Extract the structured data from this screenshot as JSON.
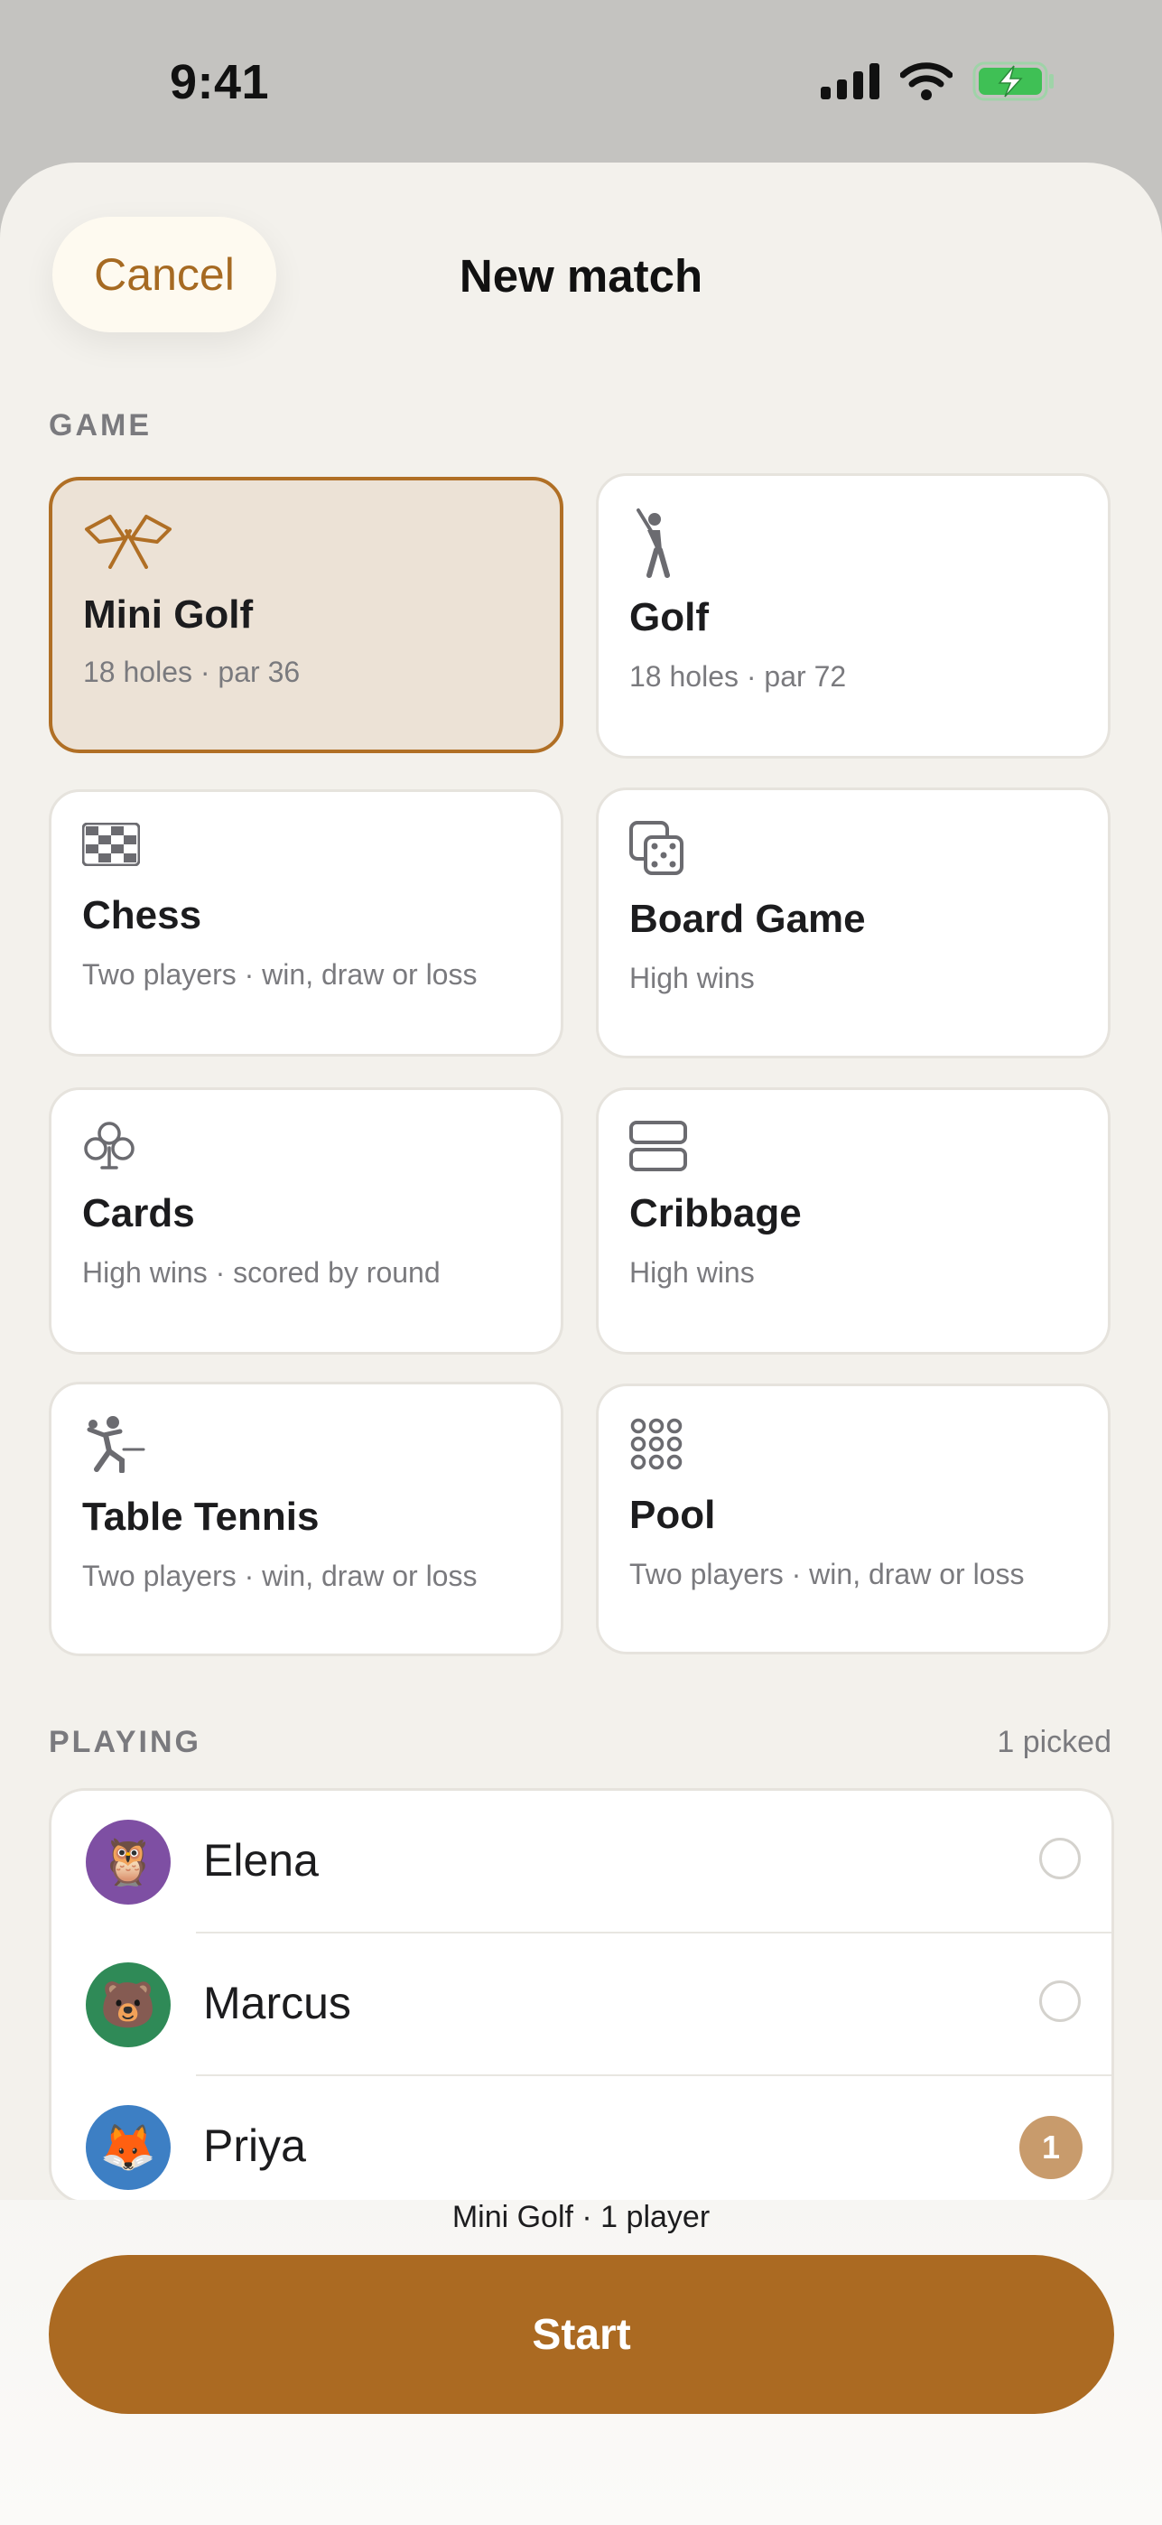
{
  "status_bar": {
    "time": "9:41"
  },
  "nav": {
    "cancel_label": "Cancel",
    "title": "New match"
  },
  "game_section": {
    "label": "GAME",
    "games": [
      {
        "name": "Mini Golf",
        "detail": "18 holes · par 36",
        "icon": "crossed-flags-icon",
        "selected": true
      },
      {
        "name": "Golf",
        "detail": "18 holes · par 72",
        "icon": "golfer-icon",
        "selected": false
      },
      {
        "name": "Chess",
        "detail": "Two players · win, draw or loss",
        "icon": "checkerboard-icon",
        "selected": false
      },
      {
        "name": "Board Game",
        "detail": "High wins",
        "icon": "dice-icon",
        "selected": false
      },
      {
        "name": "Cards",
        "detail": "High wins · scored by round",
        "icon": "club-suit-icon",
        "selected": false
      },
      {
        "name": "Cribbage",
        "detail": "High wins",
        "icon": "cribbage-board-icon",
        "selected": false
      },
      {
        "name": "Table Tennis",
        "detail": "Two players · win, draw or loss",
        "icon": "table-tennis-player-icon",
        "selected": false
      },
      {
        "name": "Pool",
        "detail": "Two players · win, draw or loss",
        "icon": "pool-balls-icon",
        "selected": false
      }
    ]
  },
  "playing_section": {
    "label": "PLAYING",
    "count_text": "1 picked",
    "players": [
      {
        "name": "Elena",
        "avatar": "🦉",
        "avatar_color": "#7e4fa3",
        "picked": false
      },
      {
        "name": "Marcus",
        "avatar": "🐻",
        "avatar_color": "#2f8a57",
        "picked": false
      },
      {
        "name": "Priya",
        "avatar": "🦊",
        "avatar_color": "#3d7fc4",
        "picked": true,
        "pick_order": "1"
      }
    ]
  },
  "footer": {
    "summary": "Mini Golf · 1 player",
    "start_label": "Start"
  },
  "colors": {
    "accent": "#ab6a22",
    "selected_card_bg": "#ece2d6",
    "sheet_bg": "#f3f1ec"
  }
}
